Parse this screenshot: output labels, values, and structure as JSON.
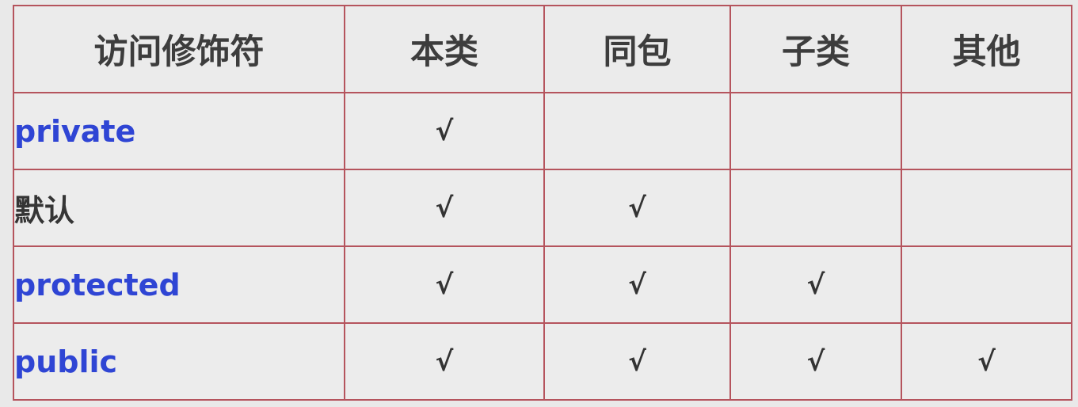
{
  "headers": [
    "访问修饰符",
    "本类",
    "同包",
    "子类",
    "其他"
  ],
  "rows": [
    {
      "modifier": "private",
      "keyword": true,
      "cells": [
        "√",
        "",
        "",
        ""
      ]
    },
    {
      "modifier": "默认",
      "keyword": false,
      "cells": [
        "√",
        "√",
        "",
        ""
      ]
    },
    {
      "modifier": "protected",
      "keyword": true,
      "cells": [
        "√",
        "√",
        "√",
        ""
      ]
    },
    {
      "modifier": "public",
      "keyword": true,
      "cells": [
        "√",
        "√",
        "√",
        "√"
      ]
    }
  ],
  "colors": {
    "keyword_text": "#2f45d4",
    "border": "#b5545d",
    "background": "#e9e9e9"
  }
}
